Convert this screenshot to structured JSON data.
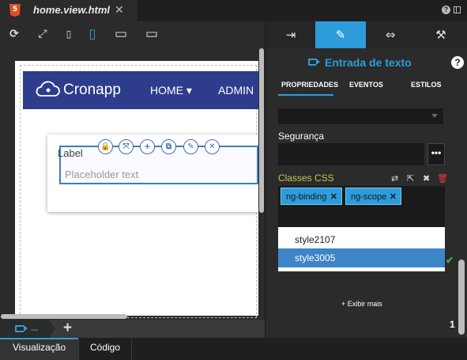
{
  "file_tab": {
    "name": "home.view.html",
    "close": "✕",
    "html5_badge": "5"
  },
  "window_controls": {
    "help": "?"
  },
  "toolbar": {
    "refresh": "⟳",
    "fullscreen": "⤢",
    "phone": "▯",
    "tablet": "▯",
    "desktop": "▭",
    "monitor": "▭"
  },
  "preview": {
    "brand": "Cronapp",
    "nav_home": "HOME ▾",
    "nav_admin": "ADMIN",
    "field_label": "Label",
    "field_placeholder": "Placeholder text",
    "tools": [
      "🔒",
      "⤧",
      "+",
      "⧉",
      "✎",
      "✕"
    ]
  },
  "page_tabs": {
    "current": "...",
    "add": "+"
  },
  "bottom_tabs": {
    "visual": "Visualização",
    "code": "Código"
  },
  "right_panel": {
    "tabs": [
      "⇥",
      "✎",
      "⇔",
      "⚒"
    ],
    "component_title": "Entrada de texto",
    "help": "?",
    "subtabs": [
      "PROPRIEDADES",
      "EVENTOS",
      "ESTILOS"
    ],
    "security_label": "Segurança",
    "security_btn": "•••",
    "css_label": "Classes CSS",
    "css_tools": [
      "⇄",
      "⇱",
      "✖",
      "🗑"
    ],
    "css_chips": [
      {
        "label": "ng-binding",
        "remove": "✕"
      },
      {
        "label": "ng-scope",
        "remove": "✕"
      }
    ],
    "autocomplete": [
      "style2107",
      "style3005"
    ],
    "check": "✔",
    "show_more": "+ Exibir mais",
    "count": "1"
  },
  "colors": {
    "accent": "#2d9cdb",
    "navbar": "#2d3d8c",
    "css_label": "#c8c84a"
  }
}
